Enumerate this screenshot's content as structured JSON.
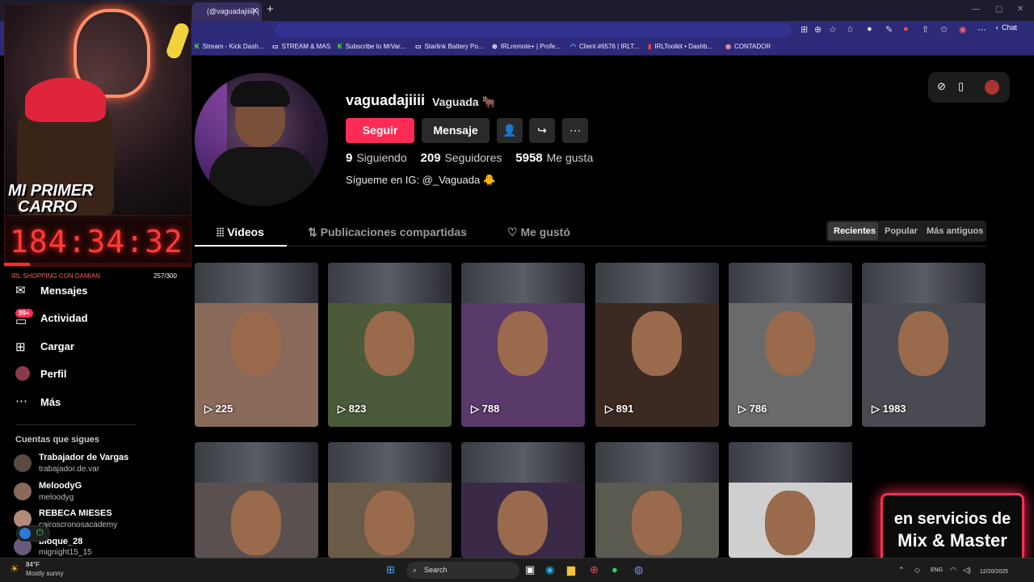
{
  "browser": {
    "tab_title": "(@vaguadajiiii) |",
    "tab_close": "✕",
    "new_tab": "+",
    "chat_label": "Chat",
    "bookmarks": [
      {
        "label": "Stream - Kick Dash...",
        "icon": "K"
      },
      {
        "label": "STREAM & MAS",
        "icon": "▭"
      },
      {
        "label": "Subscribe to MrVar...",
        "icon": "K"
      },
      {
        "label": "Starlink Battery Po...",
        "icon": "▭"
      },
      {
        "label": "IRLremote+ | Profe...",
        "icon": "⊕"
      },
      {
        "label": "Client #6576 | IRLT...",
        "icon": "◠"
      },
      {
        "label": "IRLToolkit • Dashb...",
        "icon": "▮"
      },
      {
        "label": "CONTADOR",
        "icon": "◉"
      }
    ]
  },
  "profile": {
    "username": "vaguadajiiii",
    "display_name": "Vaguada 🐂",
    "follow_label": "Seguir",
    "message_label": "Mensaje",
    "following_count": "9",
    "following_label": "Siguiendo",
    "followers_count": "209",
    "followers_label": "Seguidores",
    "likes_count": "5958",
    "likes_label": "Me gusta",
    "bio": "Sígueme en IG: @_Vaguada 🐥"
  },
  "tabs": [
    {
      "label": "Videos",
      "icon": "grid-icon"
    },
    {
      "label": "Publicaciones compartidas",
      "icon": "repost-icon"
    },
    {
      "label": "Me gustó",
      "icon": "heart-icon"
    }
  ],
  "sort": {
    "recent": "Recientes",
    "popular": "Popular",
    "oldest": "Más antiguos"
  },
  "videos": [
    {
      "views": "225",
      "color": "#8a6a5a"
    },
    {
      "views": "823",
      "color": "#4a5a3a"
    },
    {
      "views": "788",
      "color": "#5a3a6a"
    },
    {
      "views": "891",
      "color": "#3a2a22"
    },
    {
      "views": "786",
      "color": "#6a6a6a"
    },
    {
      "views": "1983",
      "color": "#4a4a52"
    },
    {
      "views": "",
      "color": "#5a5050"
    },
    {
      "views": "",
      "color": "#6a5a48"
    },
    {
      "views": "",
      "color": "#3a2a48"
    },
    {
      "views": "",
      "color": "#5a5a50"
    },
    {
      "views": "",
      "color": "#cfcfcf"
    }
  ],
  "sidebar": {
    "nav": [
      {
        "label": "Mensajes",
        "icon": "message-icon"
      },
      {
        "label": "Actividad",
        "icon": "inbox-icon",
        "badge": "99+"
      },
      {
        "label": "Cargar",
        "icon": "upload-icon"
      },
      {
        "label": "Perfil",
        "icon": "avatar"
      },
      {
        "label": "Más",
        "icon": "more-icon"
      }
    ],
    "following_title": "Cuentas que sigues",
    "following": [
      {
        "name": "Trabajador de Vargas",
        "user": "trabajador.de.var"
      },
      {
        "name": "MeloodyG",
        "user": "meloodyg"
      },
      {
        "name": "REBECA MIESES",
        "user": "cairoscronosacademy"
      },
      {
        "name": "bloque_28",
        "user": "mignight15_15"
      }
    ]
  },
  "overlay": {
    "title_line1": "MI PRIMER",
    "title_line2": "CARRO",
    "timer": "184:34:32",
    "goal_label": "IRL SHOPPING CON DAMIAN",
    "goal_count": "257/300",
    "goal_progress": 0.14,
    "promo_line1": "en servicios de",
    "promo_line2": "Mix & Master",
    "accent": "#ff2d55"
  },
  "taskbar": {
    "temp": "84°F",
    "weather": "Mostly sunny",
    "search": "Search",
    "lang": "ENG",
    "date": "12/20/2025"
  }
}
